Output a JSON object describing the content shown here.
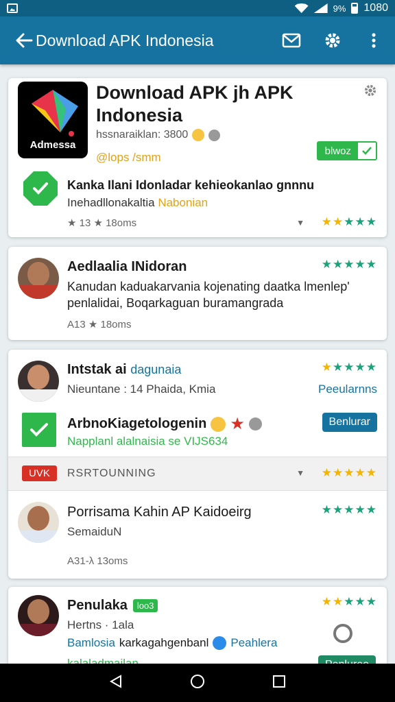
{
  "status_bar": {
    "battery_text": "9%",
    "time": "1080"
  },
  "app_bar": {
    "title": "Download APK Indonesia"
  },
  "featured": {
    "title": "Download APK jh APK Indonesia",
    "icon_label": "Admessa",
    "subtitle": "hssnaraiklan: 3800",
    "developer": "@lops /smm",
    "install_label": "blwoz",
    "verified": {
      "title": "Kanka Ilani Idonladar kehieokanlao gnnnu",
      "subtitle_part1": "Inehadllonakaltia ",
      "subtitle_highlight": "Nabonian",
      "meta": "★ 13 ★ 18oms"
    }
  },
  "card2": {
    "title": "Aedlaalia INidoran",
    "description": "Kanudan kaduakarvania kojenating daatka lmenlep' penlalidai, Boqarkaguan buramangrada",
    "meta": "A13 ★ 18oms"
  },
  "card3": {
    "title": "Intstak ai",
    "title_link": "dagunaia",
    "subtitle": "Nieuntane : 14 Phaida, Kmia",
    "action": "Peeularnns",
    "sub_title": "ArbnoKiagetologenin",
    "sub_subtitle": "Napplanl alalnaisia se VIJS634",
    "button_label": "Benlurar",
    "bar_badge": "UVK",
    "bar_label": "RSRTOUNNING"
  },
  "card4": {
    "title": "Porrisama Kahin AP Kaidoeirg",
    "subtitle": "SemaiduN",
    "meta": "A31-λ 13oms"
  },
  "card5": {
    "title": "Penulaka",
    "badge": "loo3",
    "subtitle": "Hertns · 1ala",
    "link_blue": "Bamlosia",
    "link_text": "karkagahgenbanl",
    "link_blue2": "Peahlera",
    "cut_text": "kalaladmailan",
    "cut_button": "Penlureo"
  },
  "colors": {
    "primary": "#1673a0",
    "accent_green": "#2eb84b",
    "star": "#f4b400",
    "badge_red": "#d93025"
  }
}
